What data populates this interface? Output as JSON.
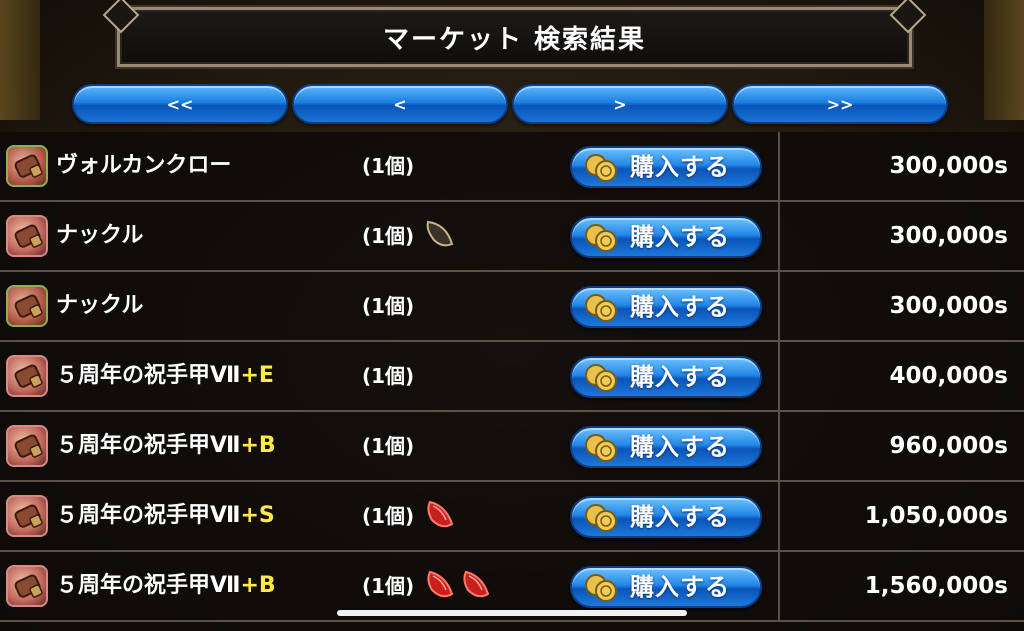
{
  "title": "マーケット 検索結果",
  "nav": {
    "first": "<<",
    "prev": "<",
    "next": ">",
    "last": ">>"
  },
  "buy_label": "購入する",
  "rows": [
    {
      "name": "ヴォルカンクロー",
      "grade": "",
      "qty": "(1個)",
      "gems": [],
      "price": "300,000s",
      "icon": "gauntlet-icon-green"
    },
    {
      "name": "ナックル",
      "grade": "",
      "qty": "(1個)",
      "gems": [
        "empty-slot"
      ],
      "price": "300,000s",
      "icon": "gauntlet-icon-pink"
    },
    {
      "name": "ナックル",
      "grade": "",
      "qty": "(1個)",
      "gems": [],
      "price": "300,000s",
      "icon": "gauntlet-icon-green"
    },
    {
      "name": "５周年の祝手甲Ⅶ",
      "grade": "+E",
      "qty": "(1個)",
      "gems": [],
      "price": "400,000s",
      "icon": "gauntlet-icon-pink"
    },
    {
      "name": "５周年の祝手甲Ⅶ",
      "grade": "+B",
      "qty": "(1個)",
      "gems": [],
      "price": "960,000s",
      "icon": "gauntlet-icon-pink"
    },
    {
      "name": "５周年の祝手甲Ⅶ",
      "grade": "+S",
      "qty": "(1個)",
      "gems": [
        "red-gem"
      ],
      "price": "1,050,000s",
      "icon": "gauntlet-icon-pink"
    },
    {
      "name": "５周年の祝手甲Ⅶ",
      "grade": "+B",
      "qty": "(1個)",
      "gems": [
        "red-gem",
        "red-gem"
      ],
      "price": "1,560,000s",
      "icon": "gauntlet-icon-pink"
    }
  ],
  "colors": {
    "grade": "#ffe84a",
    "button_blue": "#1c7fe0"
  }
}
